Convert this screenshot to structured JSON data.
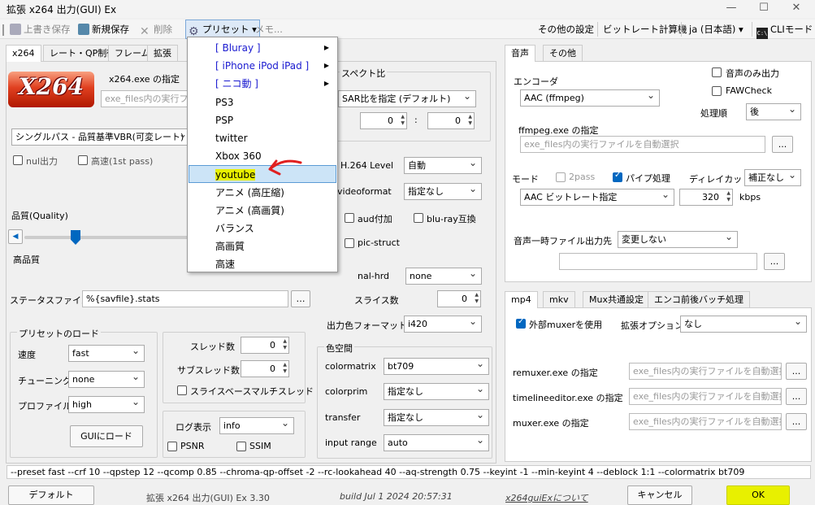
{
  "window": {
    "title": "拡張 x264 出力(GUI) Ex"
  },
  "toolbar": {
    "overwrite_save": "上書き保存",
    "new_save": "新規保存",
    "delete": "削除",
    "preset": "プリセット",
    "memo": "メモ...",
    "other_settings": "その他の設定",
    "bitrate_calc": "ビットレート計算機",
    "language": "ja (日本語)",
    "cli_mode": "CLIモード"
  },
  "left_tabs": [
    "x264",
    "レート・QP制御",
    "フレーム",
    "拡張"
  ],
  "preset_menu": {
    "items": [
      {
        "label": "[ Bluray ]",
        "submenu": true,
        "blue": true
      },
      {
        "label": "[ iPhone iPod iPad ]",
        "submenu": true,
        "blue": true
      },
      {
        "label": "[ ニコ動 ]",
        "submenu": true,
        "blue": true
      },
      {
        "label": "PS3"
      },
      {
        "label": "PSP"
      },
      {
        "label": "twitter"
      },
      {
        "label": "Xbox 360"
      },
      {
        "label": "youtube",
        "selected": true
      },
      {
        "label": "アニメ (高圧縮)"
      },
      {
        "label": "アニメ (高画質)"
      },
      {
        "label": "バランス"
      },
      {
        "label": "高画質"
      },
      {
        "label": "高速"
      }
    ]
  },
  "x264": {
    "logo": "X264",
    "exe_label": "x264.exe の指定",
    "exe_placeholder": "exe_files内の実行ファイ",
    "mode": "シングルパス - 品質基準VBR(可変レート)",
    "nul_output": "nul出力",
    "fast_1st": "高速(1st pass)",
    "quality_label": "品質(Quality)",
    "quality_low": "高品質",
    "quality_value": 0.3,
    "status_file_label": "ステータスファイル",
    "status_file_value": "%{savfile}.stats"
  },
  "preset_load": {
    "title": "プリセットのロード",
    "speed_label": "速度",
    "speed_value": "fast",
    "tuning_label": "チューニング",
    "tuning_value": "none",
    "profile_label": "プロファイル",
    "profile_value": "high",
    "load_button": "GUIにロード"
  },
  "threads": {
    "thread_label": "スレッド数",
    "thread_value": "0",
    "subthread_label": "サブスレッド数",
    "subthread_value": "0",
    "slice_mt": "スライスベースマルチスレッド"
  },
  "log": {
    "label": "ログ表示",
    "value": "info",
    "psnr": "PSNR",
    "ssim": "SSIM"
  },
  "aspect": {
    "title": "スペクト比",
    "sar_mode": "SAR比を指定 (デフォルト)",
    "w": "0",
    "h": "0",
    "colon": ":"
  },
  "h264": {
    "level_label": "H.264 Level",
    "level_value": "自動",
    "videoformat_label": "videoformat",
    "videoformat_value": "指定なし",
    "aud": "aud付加",
    "bluray": "blu-ray互換",
    "pic_struct": "pic-struct",
    "nal_hrd_label": "nal-hrd",
    "nal_hrd_value": "none",
    "slices_label": "スライス数",
    "slices_value": "0",
    "out_csp_label": "出力色フォーマット",
    "out_csp_value": "i420"
  },
  "colorspace": {
    "title": "色空間",
    "colormatrix_label": "colormatrix",
    "colormatrix_value": "bt709",
    "colorprim_label": "colorprim",
    "colorprim_value": "指定なし",
    "transfer_label": "transfer",
    "transfer_value": "指定なし",
    "input_range_label": "input range",
    "input_range_value": "auto"
  },
  "audio": {
    "tabs": [
      "音声",
      "その他"
    ],
    "encoder_label": "エンコーダ",
    "encoder_value": "AAC (ffmpeg)",
    "audio_only": "音声のみ出力",
    "faw_check": "FAWCheck",
    "order_label": "処理順",
    "order_value": "後",
    "ffmpeg_label": "ffmpeg.exe の指定",
    "ffmpeg_placeholder": "exe_files内の実行ファイルを自動選択",
    "browse": "...",
    "mode_label": "モード",
    "two_pass": "2pass",
    "pipe": "パイプ処理",
    "delay_cut_label": "ディレイカット",
    "delay_cut_value": "補正なし",
    "mode_value": "AAC ビットレート指定",
    "bitrate": "320",
    "kbps": "kbps",
    "temp_label": "音声一時ファイル出力先",
    "temp_value": "変更しない"
  },
  "mux": {
    "tabs": [
      "mp4",
      "mkv",
      "Mux共通設定",
      "エンコ前後バッチ処理"
    ],
    "external_muxer": "外部muxerを使用",
    "ext_option_label": "拡張オプション",
    "ext_option_value": "なし",
    "remuxer_label": "remuxer.exe の指定",
    "timeline_label": "timelineeditor.exe の指定",
    "muxer_label": "muxer.exe の指定",
    "placeholder": "exe_files内の実行ファイルを自動選択"
  },
  "cmdline": "--preset fast --crf 10 --qpstep 12 --qcomp 0.85 --chroma-qp-offset -2 --rc-lookahead 40 --aq-strength 0.75 --keyint -1 --min-keyint 4 --deblock 1:1 --colormatrix bt709",
  "footer": {
    "default_button": "デフォルト",
    "version": "拡張 x264 出力(GUI) Ex 3.30",
    "build": "build Jul  1 2024 20:57:31",
    "about_link": "x264guiExについて",
    "cancel": "キャンセル",
    "ok": "OK"
  },
  "colors": {
    "accent": "#0067c0",
    "highlight": "#e8f000",
    "annotation_arrow": "#e02020"
  }
}
